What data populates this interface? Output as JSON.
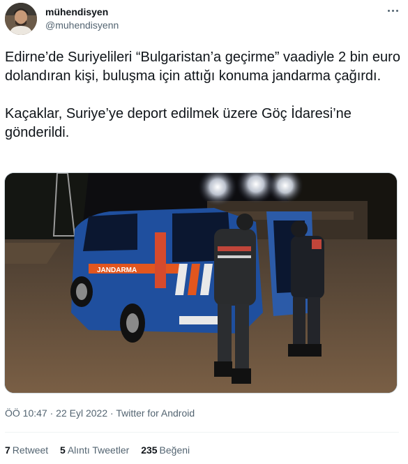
{
  "user": {
    "name": "mühendisyen",
    "handle": "@muhendisyenn"
  },
  "tweet": {
    "paragraphs": [
      "Edirne’de Suriyelileri “Bulgaristan’a geçirme” vaadiyle 2 bin euro dolandıran kişi, buluşma için attığı konuma jandarma çağırdı.",
      "Kaçaklar, Suriye’ye deport edilmek üzere Göç İdaresi’ne gönderildi."
    ],
    "media": {
      "vehicle_text": "JANDARMA"
    }
  },
  "meta": {
    "time": "ÖÖ 10:47",
    "separator": " · ",
    "date": "22 Eyl 2022",
    "source": "Twitter for Android"
  },
  "stats": {
    "retweets_count": "7",
    "retweets_label": "Retweet",
    "quotes_count": "5",
    "quotes_label": "Alıntı Tweetler",
    "likes_count": "235",
    "likes_label": "Beğeni"
  },
  "colors": {
    "text": "#0f1419",
    "secondary": "#536471",
    "divider": "#eff3f4",
    "van_blue": "#1f4f9e",
    "jandarma_orange": "#e2561e"
  }
}
